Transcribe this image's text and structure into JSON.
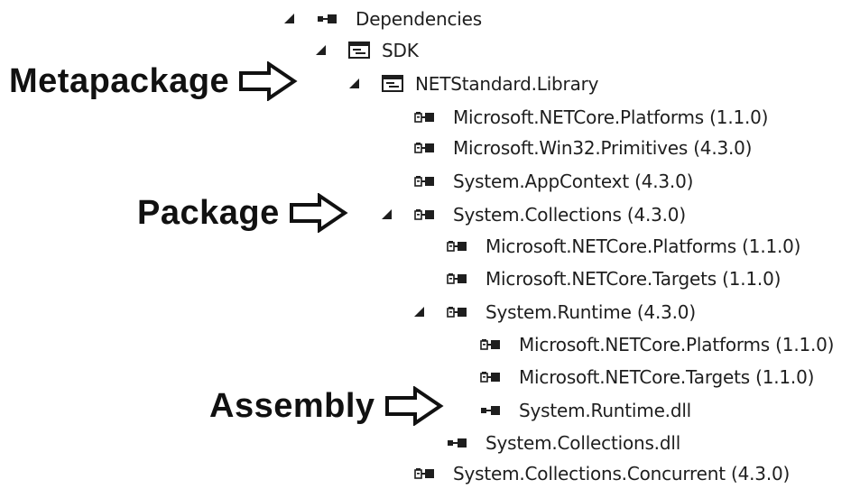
{
  "tree": {
    "items": [
      {
        "label": "Dependencies",
        "icon": "dependencies-icon",
        "state": "expanded"
      },
      {
        "label": "SDK",
        "icon": "sdk-icon",
        "state": "expanded"
      },
      {
        "label": "NETStandard.Library",
        "icon": "metapackage-icon",
        "state": "expanded"
      },
      {
        "label": "Microsoft.NETCore.Platforms (1.1.0)",
        "icon": "package-icon",
        "state": "none"
      },
      {
        "label": "Microsoft.Win32.Primitives (4.3.0)",
        "icon": "package-icon",
        "state": "collapsed"
      },
      {
        "label": "System.AppContext (4.3.0)",
        "icon": "package-icon",
        "state": "collapsed"
      },
      {
        "label": "System.Collections (4.3.0)",
        "icon": "package-icon",
        "state": "expanded"
      },
      {
        "label": "Microsoft.NETCore.Platforms (1.1.0)",
        "icon": "package-icon",
        "state": "none"
      },
      {
        "label": "Microsoft.NETCore.Targets (1.1.0)",
        "icon": "package-icon",
        "state": "none"
      },
      {
        "label": "System.Runtime (4.3.0)",
        "icon": "package-icon",
        "state": "expanded"
      },
      {
        "label": "Microsoft.NETCore.Platforms (1.1.0)",
        "icon": "package-icon",
        "state": "none"
      },
      {
        "label": "Microsoft.NETCore.Targets (1.1.0)",
        "icon": "package-icon",
        "state": "none"
      },
      {
        "label": "System.Runtime.dll",
        "icon": "assembly-icon",
        "state": "none"
      },
      {
        "label": "System.Collections.dll",
        "icon": "assembly-icon",
        "state": "none"
      },
      {
        "label": "System.Collections.Concurrent (4.3.0)",
        "icon": "package-icon",
        "state": "collapsed"
      }
    ]
  },
  "callouts": {
    "metapackage": "Metapackage",
    "package": "Package",
    "assembly": "Assembly"
  }
}
